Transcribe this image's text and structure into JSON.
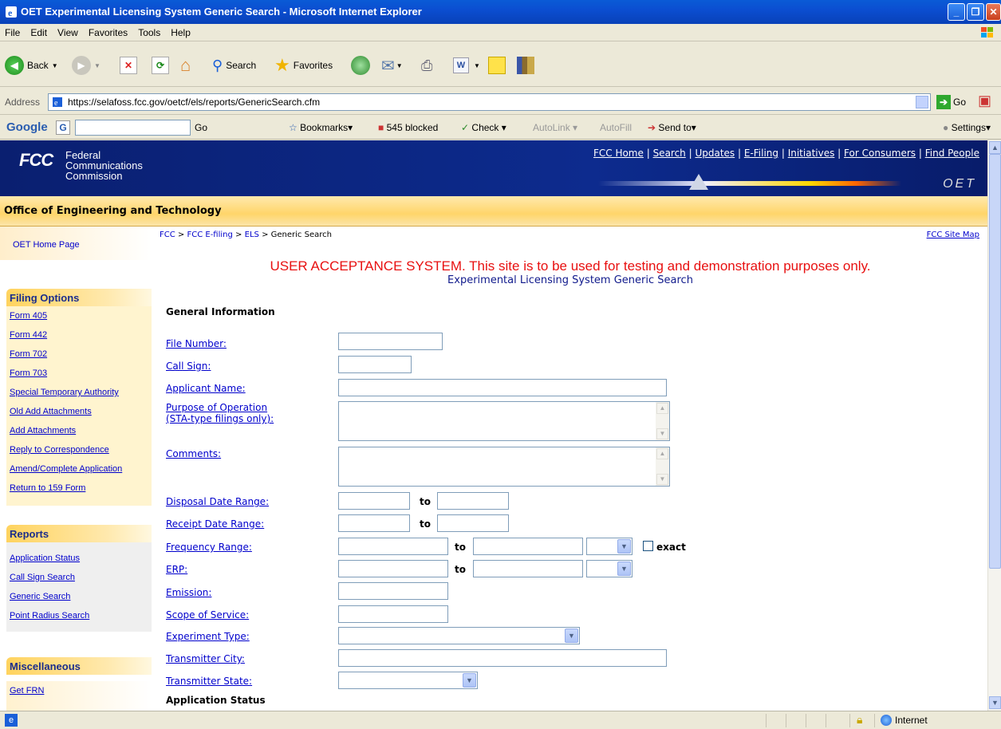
{
  "window": {
    "title": "OET Experimental Licensing System Generic Search - Microsoft Internet Explorer"
  },
  "menu": [
    "File",
    "Edit",
    "View",
    "Favorites",
    "Tools",
    "Help"
  ],
  "toolbar": {
    "back_label": "Back",
    "search_label": "Search",
    "favorites_label": "Favorites"
  },
  "address": {
    "label": "Address",
    "url": "https://selafoss.fcc.gov/oetcf/els/reports/GenericSearch.cfm",
    "go_label": "Go"
  },
  "googlebar": {
    "logo": "Google",
    "go_label": "Go",
    "bookmarks_label": "Bookmarks",
    "blocked_label": "545 blocked",
    "check_label": "Check",
    "autolink_label": "AutoLink",
    "autofill_label": "AutoFill",
    "sendto_label": "Send to",
    "settings_label": "Settings"
  },
  "header": {
    "logo_big": "FCC",
    "logo_line1": "Federal",
    "logo_line2": "Communications",
    "logo_line3": "Commission",
    "nav": [
      "FCC Home",
      "Search",
      "Updates",
      "E-Filing",
      "Initiatives",
      "For Consumers",
      "Find People"
    ],
    "oet_mark": "OET",
    "office_title": "Office of Engineering and Technology"
  },
  "sidebar": {
    "home_link": "OET Home Page",
    "filing_heading": "Filing Options",
    "filing_items": [
      "Form 405",
      "Form 442",
      "Form 702",
      "Form 703",
      "Special Temporary Authority",
      "Old Add Attachments",
      "Add Attachments",
      "Reply to Correspondence",
      "Amend/Complete Application",
      "Return to 159 Form"
    ],
    "reports_heading": "Reports",
    "reports_items": [
      "Application Status",
      "Call Sign Search",
      "Generic Search",
      "Point Radius Search"
    ],
    "misc_heading": "Miscellaneous",
    "misc_items": [
      "Get FRN"
    ]
  },
  "breadcrumb": {
    "items": [
      "FCC",
      "FCC E-filing",
      "ELS"
    ],
    "current": "Generic Search",
    "separator": ">"
  },
  "site_map": "FCC Site Map",
  "warning": "USER ACCEPTANCE SYSTEM. This site is to be used for testing and demonstration purposes only.",
  "page_title": "Experimental Licensing System Generic Search",
  "form": {
    "general_heading": "General Information",
    "file_number": "File Number:",
    "call_sign": "Call Sign:",
    "applicant_name": "Applicant Name:",
    "purpose_line1": "Purpose of Operation",
    "purpose_line2": "(STA-type filings only):",
    "comments": "Comments:",
    "disposal_date": "Disposal Date Range:",
    "receipt_date": "Receipt Date Range:",
    "frequency_range": "Frequency Range:",
    "erp": "ERP:",
    "emission": "Emission:",
    "scope_of_service": "Scope of Service:",
    "experiment_type": "Experiment Type:",
    "transmitter_city": "Transmitter City:",
    "transmitter_state": "Transmitter State:",
    "to_label": "to",
    "exact_label": "exact",
    "status_heading": "Application Status"
  },
  "status": {
    "zone": "Internet"
  },
  "colors": {
    "warning_red": "#e81010",
    "link_blue": "#0000cc",
    "banner_navy": "#0d2b8e",
    "strip_gold": "#ffd56a"
  }
}
